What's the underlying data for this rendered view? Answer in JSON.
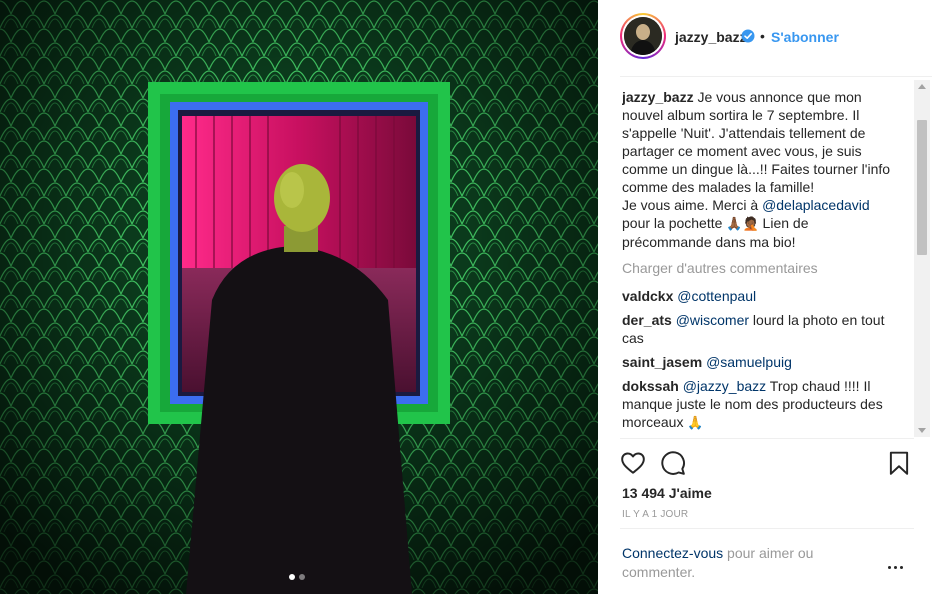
{
  "post": {
    "username": "jazzy_bazz",
    "follow_label": "S'abonner",
    "bullet": "•",
    "caption": {
      "username": "jazzy_bazz",
      "line_1": " Je vous annonce que mon nouvel album sortira le 7 septembre. Il s'appelle 'Nuit'. J'attendais tellement de partager ce moment avec vous, je suis comme un dingue là...!! Faites tourner l'info comme des malades la famille!",
      "line_2_prefix": "Je vous aime. Merci à ",
      "mention": "@delaplacedavid",
      "line_2_suffix": " pour la pochette ",
      "emojis": "🙏🏾🤦🏾",
      "line_2_end": " Lien de précommande dans ma bio!"
    },
    "load_more_label": "Charger d'autres commentaires",
    "comments": [
      {
        "user": "valdckx",
        "mention": "@cottenpaul",
        "text": ""
      },
      {
        "user": "der_ats",
        "mention": "@wiscomer",
        "text": " lourd la photo en tout cas"
      },
      {
        "user": "saint_jasem",
        "mention": "@samuelpuig",
        "text": ""
      },
      {
        "user": "dokssah",
        "mention": "@jazzy_bazz",
        "text": " Trop chaud !!!! Il manque juste le nom des producteurs des morceaux ",
        "emoji": "🙏"
      }
    ],
    "likes_label": "13 494 J'aime",
    "time_label": "IL Y A 1 JOUR",
    "login_link": "Connectez-vous",
    "login_rest": " pour aimer ou commenter.",
    "icons": {
      "like": "heart-outline-icon",
      "comment": "speech-bubble-icon",
      "save": "bookmark-icon",
      "verified": "verified-badge-icon",
      "more": "more-options-icon"
    },
    "colors": {
      "accent": "#3897f0",
      "link": "#003569",
      "muted": "#999999",
      "text": "#262626"
    },
    "carousel": {
      "count": 2,
      "active": 1
    }
  }
}
